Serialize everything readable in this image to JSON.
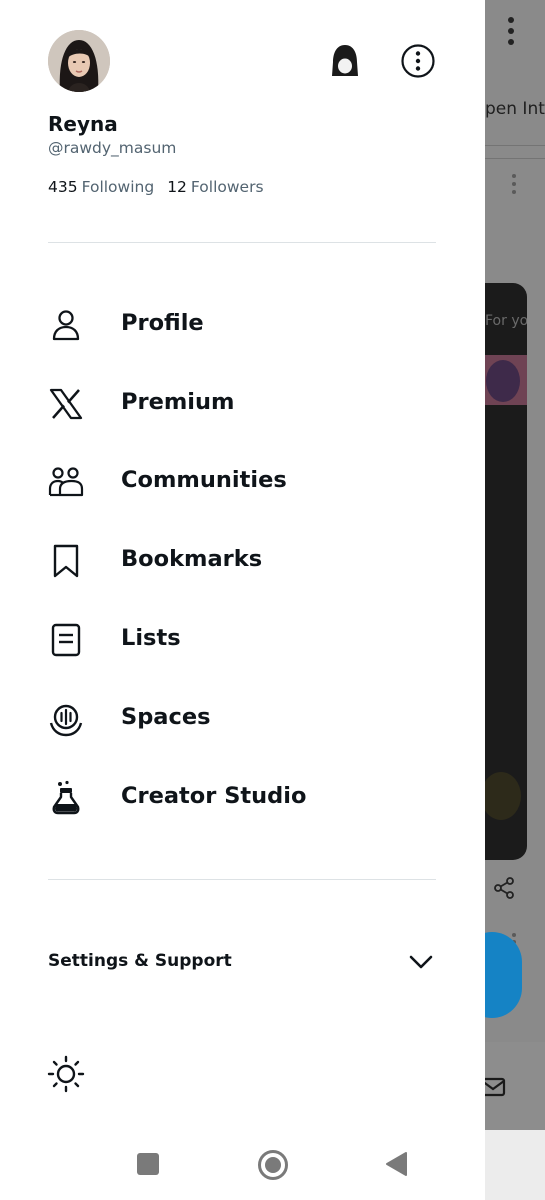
{
  "profile": {
    "display_name": "Reyna",
    "handle": "@rawdy_masum",
    "following_count": "435",
    "following_label": "Following",
    "followers_count": "12",
    "followers_label": "Followers"
  },
  "menu": {
    "items": [
      {
        "label": "Profile",
        "icon": "person-icon"
      },
      {
        "label": "Premium",
        "icon": "x-logo-icon"
      },
      {
        "label": "Communities",
        "icon": "communities-icon"
      },
      {
        "label": "Bookmarks",
        "icon": "bookmark-icon"
      },
      {
        "label": "Lists",
        "icon": "list-icon"
      },
      {
        "label": "Spaces",
        "icon": "spaces-icon"
      },
      {
        "label": "Creator Studio",
        "icon": "flask-icon"
      }
    ]
  },
  "settings_support": {
    "label": "Settings & Support",
    "icon": "chevron-down-icon"
  },
  "background": {
    "tab_text": "pen Intel",
    "card_label": "For yo"
  },
  "colors": {
    "text_primary": "#0f1419",
    "text_secondary": "#536471",
    "divider": "#dde2e5",
    "fab_blue": "#1583c5"
  }
}
